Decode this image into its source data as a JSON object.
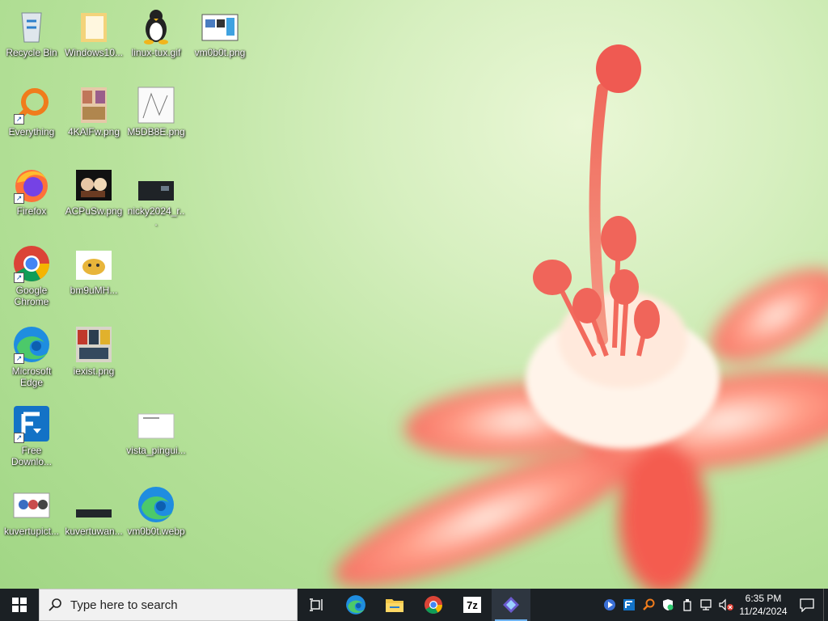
{
  "desktop": {
    "icons": [
      {
        "label": "Recycle Bin",
        "icon": "recycle-bin-icon"
      },
      {
        "label": "Windows10...",
        "icon": "folder-icon"
      },
      {
        "label": "linux-tux.gif",
        "icon": "tux-penguin-icon"
      },
      {
        "label": "vm0b0t.png",
        "icon": "image-thumbnail-icon"
      },
      {
        "label": "Everything",
        "icon": "everything-search-icon"
      },
      {
        "label": "4KAlFw.png",
        "icon": "image-thumbnail-icon"
      },
      {
        "label": "M5DB8E.png",
        "icon": "image-thumbnail-icon"
      },
      {
        "label": "Firefox",
        "icon": "firefox-icon"
      },
      {
        "label": "ACPuSw.png",
        "icon": "image-thumbnail-icon"
      },
      {
        "label": "nicky2024_r...",
        "icon": "image-thumbnail-icon"
      },
      {
        "label": "Google Chrome",
        "icon": "chrome-icon"
      },
      {
        "label": "bm9uMH...",
        "icon": "image-thumbnail-icon"
      },
      {
        "label": "Microsoft Edge",
        "icon": "edge-icon"
      },
      {
        "label": "iexist.png",
        "icon": "image-thumbnail-icon"
      },
      {
        "label": "Free Downlo...",
        "icon": "free-download-manager-icon"
      },
      {
        "label": "vista_pingui...",
        "icon": "image-thumbnail-icon"
      },
      {
        "label": "kuvertupict...",
        "icon": "image-thumbnail-icon"
      },
      {
        "label": "kuvertuwan...",
        "icon": "image-thumbnail-icon"
      },
      {
        "label": "vm0b0t.webp",
        "icon": "edge-icon"
      }
    ]
  },
  "taskbar": {
    "search_placeholder": "Type here to search",
    "pinned": [
      "task-view-icon",
      "edge-icon",
      "file-explorer-icon",
      "chrome-icon",
      "7zip-icon",
      "app-icon"
    ],
    "seven_zip_text": "7z",
    "clock_time": "6:35 PM",
    "clock_date": "11/24/2024"
  },
  "colors": {
    "taskbar_bg": "#1b2024",
    "accent": "#6fb4f2"
  }
}
